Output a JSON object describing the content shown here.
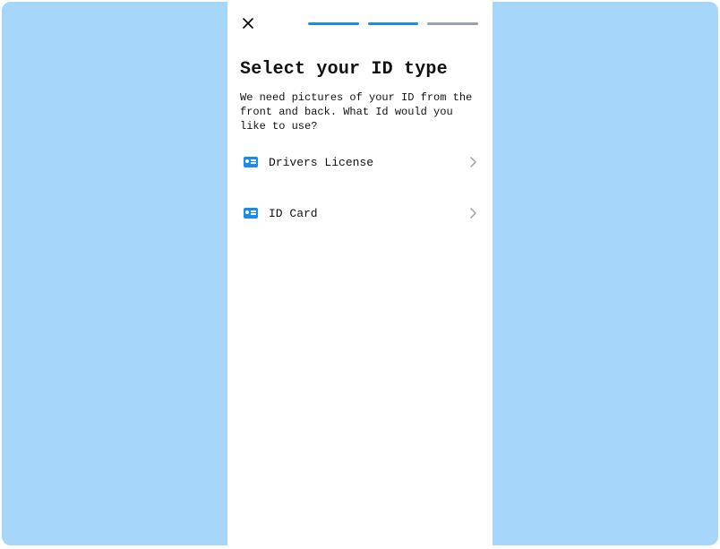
{
  "colors": {
    "accent": "#1a8cf0",
    "muted": "#9aa2ae",
    "backdrop": "#a6d6f9"
  },
  "progress": {
    "segments": [
      "done",
      "done",
      "todo"
    ]
  },
  "header": {
    "title": "Select your ID type",
    "subtitle": "We need pictures of your ID from the front and back. What Id would you like to use?"
  },
  "options": [
    {
      "icon": "id-card-icon",
      "label": "Drivers License"
    },
    {
      "icon": "id-card-icon",
      "label": "ID Card"
    }
  ]
}
